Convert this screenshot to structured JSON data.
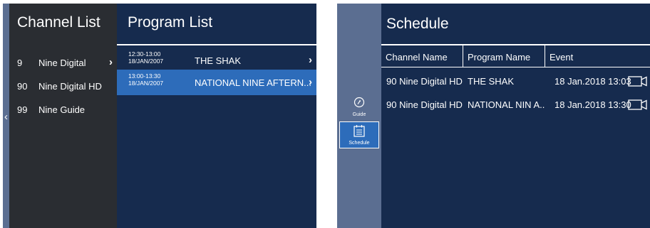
{
  "left_screen": {
    "back_arrow": "‹",
    "channel_list": {
      "title": "Channel List",
      "items": [
        {
          "number": "9",
          "name": "Nine Digital",
          "chevron": "›"
        },
        {
          "number": "90",
          "name": "Nine Digital HD"
        },
        {
          "number": "99",
          "name": "Nine Guide"
        }
      ]
    },
    "program_list": {
      "title": "Program List",
      "items": [
        {
          "time": "12:30-13:00",
          "date": "18/JAN/2007",
          "name": "THE SHAK",
          "chevron": "›",
          "selected": false
        },
        {
          "time": "13:00-13:30",
          "date": "18/JAN/2007",
          "name": "NATIONAL NINE AFTERN...",
          "chevron": "›",
          "selected": true
        }
      ]
    }
  },
  "right_screen": {
    "sidebar": {
      "guide_label": "Guide",
      "schedule_label": "Schedule",
      "active": "schedule"
    },
    "schedule": {
      "title": "Schedule",
      "columns": [
        "Channel Name",
        "Program Name",
        "Event"
      ],
      "rows": [
        {
          "channel": "90 Nine Digital HD",
          "program": "THE SHAK",
          "event": "18 Jan.2018 13:03",
          "icon": "video-camera-icon"
        },
        {
          "channel": "90 Nine Digital HD",
          "program": "NATIONAL NIN A..",
          "event": "18 Jan.2018 13:30",
          "icon": "video-camera-icon"
        }
      ]
    }
  },
  "colors": {
    "dark_navy": "#162b4e",
    "charcoal": "#2a2d32",
    "slate_blue": "#5b6e91",
    "highlight_blue": "#2d6cba"
  }
}
